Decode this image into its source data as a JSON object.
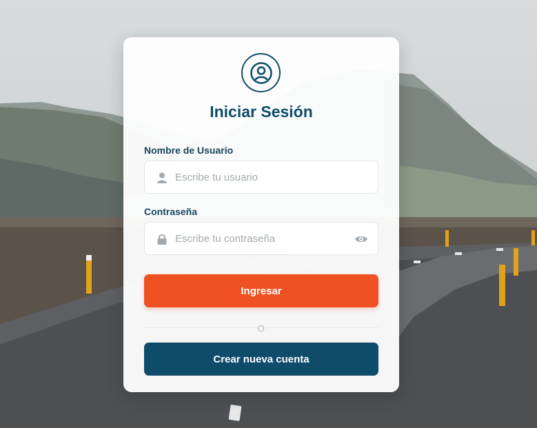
{
  "login": {
    "title": "Iniciar Sesión",
    "username": {
      "label": "Nombre de Usuario",
      "placeholder": "Escribe tu usuario",
      "value": ""
    },
    "password": {
      "label": "Contraseña",
      "placeholder": "Escribe tu contraseña",
      "value": ""
    },
    "submit_label": "Ingresar",
    "create_account_label": "Crear nueva cuenta"
  },
  "icons": {
    "avatar": "user-circle-icon",
    "username": "user-icon",
    "password": "lock-icon",
    "toggle_password": "eye-icon",
    "divider": "circle-icon"
  },
  "colors": {
    "primary": "#f05122",
    "secondary": "#0f4c6a",
    "heading": "#0f4c6a"
  }
}
